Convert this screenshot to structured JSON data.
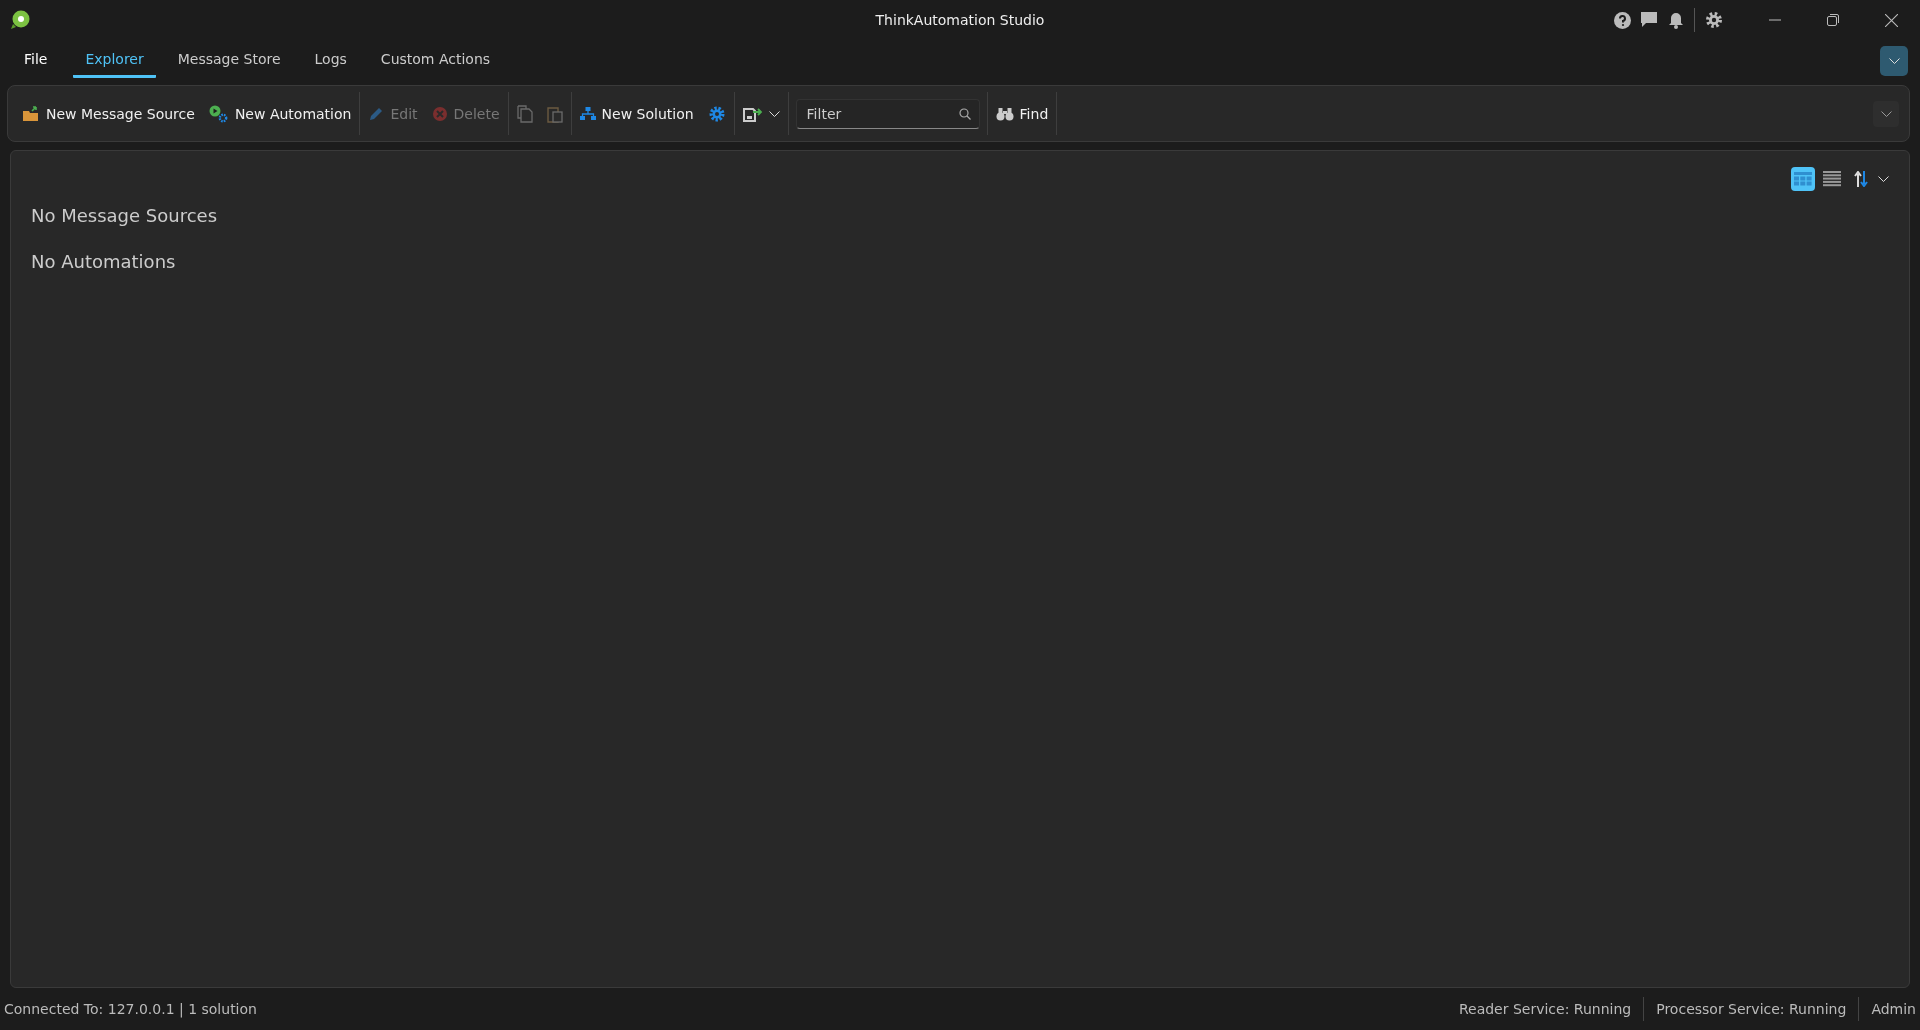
{
  "window": {
    "title": "ThinkAutomation Studio"
  },
  "tabs": [
    {
      "label": "File",
      "selected": false
    },
    {
      "label": "Explorer",
      "selected": true
    },
    {
      "label": "Message Store",
      "selected": false
    },
    {
      "label": "Logs",
      "selected": false
    },
    {
      "label": "Custom Actions",
      "selected": false
    }
  ],
  "toolbar": {
    "groups": [
      [
        {
          "kind": "button",
          "label": "New Message Source",
          "disabled": false
        },
        {
          "kind": "button",
          "label": "New Automation",
          "disabled": false
        }
      ],
      [
        {
          "kind": "button",
          "label": "Edit",
          "disabled": true
        },
        {
          "kind": "button",
          "label": "Delete",
          "disabled": true
        }
      ],
      [
        {
          "kind": "icon",
          "disabled": true
        },
        {
          "kind": "icon",
          "disabled": true
        }
      ],
      [
        {
          "kind": "button",
          "label": "New Solution",
          "disabled": false
        },
        {
          "kind": "icon",
          "disabled": false
        }
      ],
      [
        {
          "kind": "dropdown"
        }
      ],
      [
        {
          "kind": "filter",
          "placeholder": "Filter"
        }
      ],
      [
        {
          "kind": "button",
          "label": "Find",
          "disabled": false
        }
      ]
    ]
  },
  "view_modes": [
    {
      "selected": true
    },
    {
      "selected": false
    }
  ],
  "content": {
    "sections": [
      "No Message Sources",
      "No Automations"
    ]
  },
  "status_bar": {
    "left": "Connected To: 127.0.0.1 | 1 solution",
    "right": [
      "Reader Service: Running",
      "Processor Service: Running",
      "Admin"
    ]
  }
}
